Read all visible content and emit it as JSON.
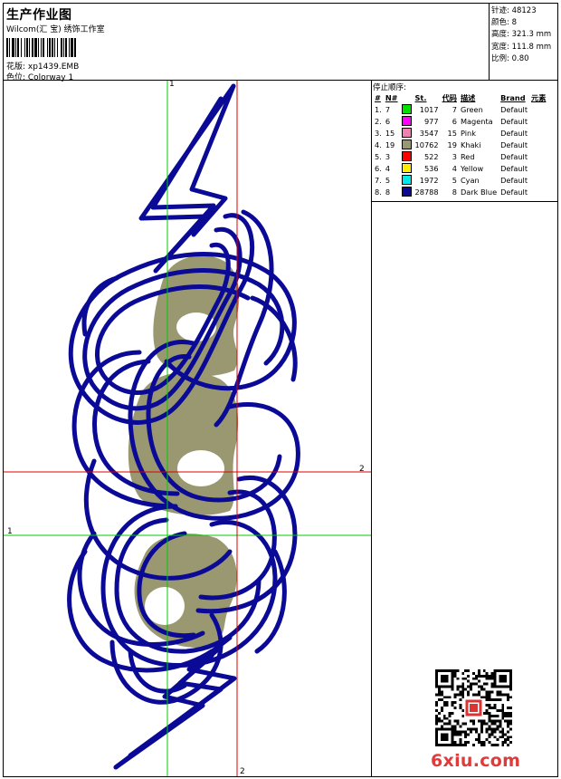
{
  "header": {
    "title": "生产作业图",
    "company": "Wilcom(汇 宝) 绣饰工作室",
    "design_label": "花版: xp1439.EMB",
    "colorway_label": "色位: Colorway 1"
  },
  "stats": [
    {
      "label": "针迹:",
      "value": "48123"
    },
    {
      "label": "颜色:",
      "value": "8"
    },
    {
      "label": "高度:",
      "value": "321.3 mm"
    },
    {
      "label": "宽度:",
      "value": "111.8 mm"
    },
    {
      "label": "比例:",
      "value": "0.80"
    }
  ],
  "sequence": {
    "title": "停止顺序:",
    "columns": [
      "#",
      "N#",
      "St.",
      "代码",
      "描述",
      "Brand",
      "元素"
    ],
    "rows": [
      {
        "idx": "1.",
        "n": "7",
        "color": "#00e000",
        "st": "1017",
        "code": "7",
        "desc": "Green",
        "brand": "Default"
      },
      {
        "idx": "2.",
        "n": "6",
        "color": "#ff00ff",
        "st": "977",
        "code": "6",
        "desc": "Magenta",
        "brand": "Default"
      },
      {
        "idx": "3.",
        "n": "15",
        "color": "#f080b0",
        "st": "3547",
        "code": "15",
        "desc": "Pink",
        "brand": "Default"
      },
      {
        "idx": "4.",
        "n": "19",
        "color": "#9a9870",
        "st": "10762",
        "code": "19",
        "desc": "Khaki",
        "brand": "Default"
      },
      {
        "idx": "5.",
        "n": "3",
        "color": "#ff0000",
        "st": "522",
        "code": "3",
        "desc": "Red",
        "brand": "Default"
      },
      {
        "idx": "6.",
        "n": "4",
        "color": "#ffee00",
        "st": "536",
        "code": "4",
        "desc": "Yellow",
        "brand": "Default"
      },
      {
        "idx": "7.",
        "n": "5",
        "color": "#00e8e8",
        "st": "1972",
        "code": "5",
        "desc": "Cyan",
        "brand": "Default"
      },
      {
        "idx": "8.",
        "n": "8",
        "color": "#0a0a96",
        "st": "28788",
        "code": "8",
        "desc": "Dark Blue",
        "brand": "Default"
      }
    ]
  },
  "canvas": {
    "axis_labels": {
      "green_top": "1",
      "green_left": "1",
      "red_right": "2",
      "red_bottom": "2"
    },
    "colors": {
      "outline": "#0a0a96",
      "fill": "#9a9870",
      "guide_green": "#00cc00",
      "guide_red": "#dd0000"
    }
  },
  "watermark": {
    "text": "6xiu.com",
    "color": "#e03a3a"
  }
}
